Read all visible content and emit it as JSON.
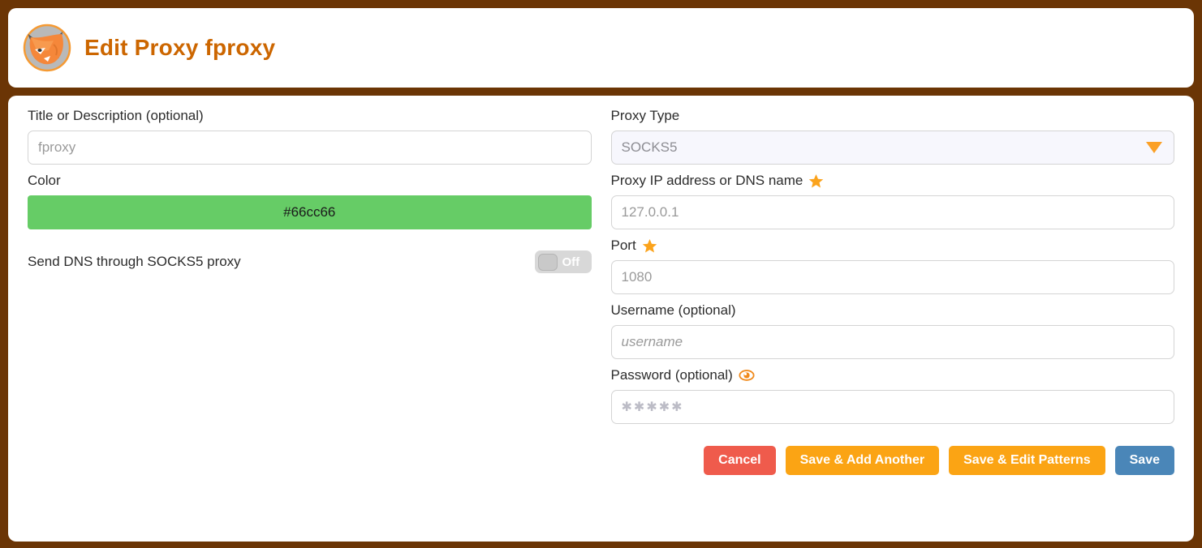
{
  "window": {
    "background_color": "#6b3505"
  },
  "header": {
    "logo_icon": "foxyproxy-fox-logo-icon",
    "title": "Edit Proxy fproxy",
    "title_color": "#cc6600"
  },
  "form": {
    "left": {
      "title_field": {
        "label": "Title or Description (optional)",
        "value": "",
        "placeholder": "fproxy"
      },
      "color_field": {
        "label": "Color",
        "value": "#66cc66",
        "swatch_color": "#66cc66"
      },
      "dns_toggle": {
        "label": "Send DNS through SOCKS5 proxy",
        "state": "Off",
        "checked": false
      }
    },
    "right": {
      "proxy_type": {
        "label": "Proxy Type",
        "selected": "SOCKS5",
        "options": [
          "SOCKS5"
        ],
        "caret_icon": "chevron-down-icon",
        "caret_color": "#fba026"
      },
      "host_field": {
        "label": "Proxy IP address or DNS name",
        "required_icon": "star-icon",
        "required_icon_color": "#fba31c",
        "value": "",
        "placeholder": "127.0.0.1"
      },
      "port_field": {
        "label": "Port",
        "required_icon": "star-icon",
        "value": "",
        "placeholder": "1080"
      },
      "username_field": {
        "label": "Username (optional)",
        "value": "",
        "placeholder": "username"
      },
      "password_field": {
        "label": "Password (optional)",
        "reveal_icon": "eye-icon",
        "reveal_icon_color": "#f08a1c",
        "value": "",
        "placeholder": "✱✱✱✱✱"
      }
    }
  },
  "buttons": {
    "cancel": {
      "label": "Cancel",
      "color": "#ef5b4c"
    },
    "save_add_another": {
      "label": "Save & Add Another",
      "color": "#fba414"
    },
    "save_edit_patterns": {
      "label": "Save & Edit Patterns",
      "color": "#fba414"
    },
    "save": {
      "label": "Save",
      "color": "#4a86b8"
    }
  }
}
